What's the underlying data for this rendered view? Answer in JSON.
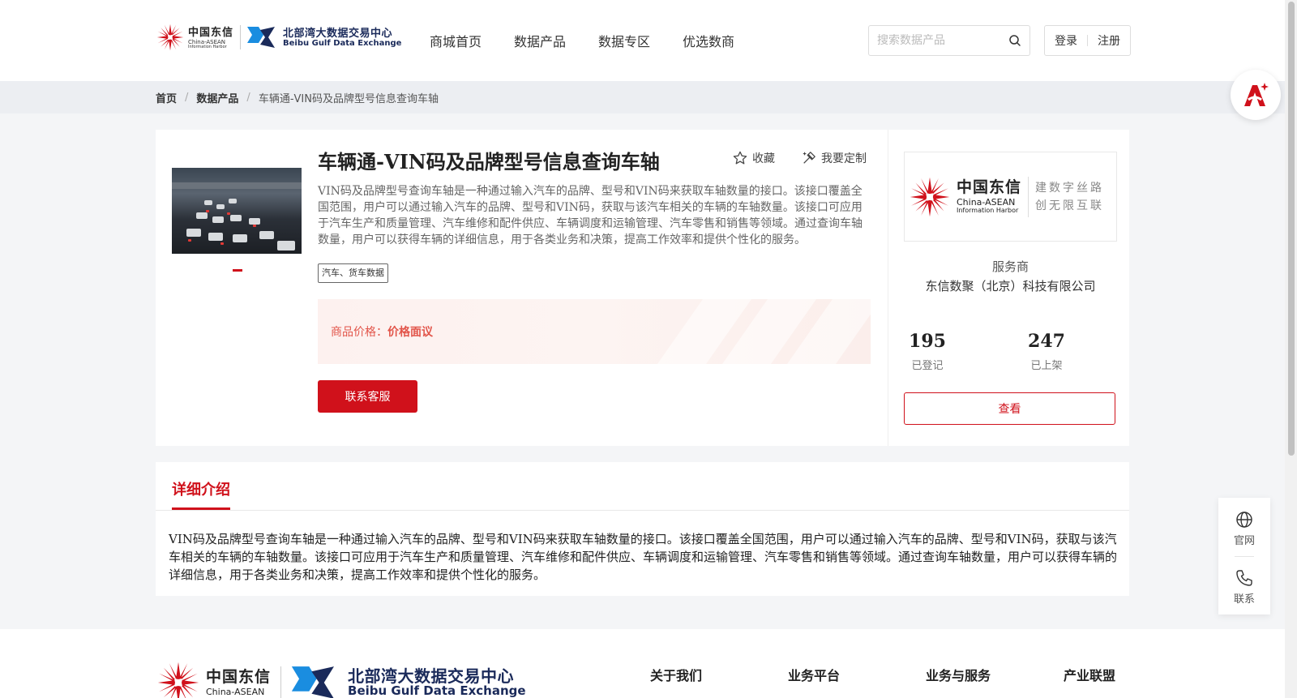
{
  "header": {
    "logo_cn": "中国东信",
    "logo_cn_en1": "China-ASEAN",
    "logo_cn_en2": "Information Harbor",
    "logo_bg_cn": "北部湾大数据交易中心",
    "logo_bg_en": "Beibu Gulf Data Exchange",
    "nav": [
      "商城首页",
      "数据产品",
      "数据专区",
      "优选数商"
    ],
    "search_placeholder": "搜索数据产品",
    "login": "登录",
    "register": "注册"
  },
  "breadcrumb": [
    "首页",
    "数据产品",
    "车辆通-VIN码及品牌型号信息查询车轴"
  ],
  "product": {
    "title": "车辆通-VIN码及品牌型号信息查询车轴",
    "favorite": "收藏",
    "customize": "我要定制",
    "description": "VIN码及品牌型号查询车轴是一种通过输入汽车的品牌、型号和VIN码来获取车轴数量的接口。该接口覆盖全国范围，用户可以通过输入汽车的品牌、型号和VIN码，获取与该汽车相关的车辆的车轴数量。该接口可应用于汽车生产和质量管理、汽车维修和配件供应、车辆调度和运输管理、汽车零售和销售等领域。通过查询车轴数量，用户可以获得车辆的详细信息，用于各类业务和决策，提高工作效率和提供个性化的服务。",
    "tag": "汽车、货车数据",
    "price_label": "商品价格：",
    "price_value": "价格面议",
    "contact_button": "联系客服"
  },
  "vendor": {
    "logo_cn": "中国东信",
    "logo_en1": "China-ASEAN",
    "logo_en2": "Information Harbor",
    "slogan1": "建数字丝路",
    "slogan2": "创无限互联",
    "label": "服务商",
    "name": "东信数聚（北京）科技有限公司",
    "registered_count": "195",
    "registered_label": "已登记",
    "listed_count": "247",
    "listed_label": "已上架",
    "view_button": "查看"
  },
  "details": {
    "tab": "详细介绍",
    "text": "VIN码及品牌型号查询车轴是一种通过输入汽车的品牌、型号和VIN码来获取车轴数量的接口。该接口覆盖全国范围，用户可以通过输入汽车的品牌、型号和VIN码，获取与该汽车相关的车辆的车轴数量。该接口可应用于汽车生产和质量管理、汽车维修和配件供应、车辆调度和运输管理、汽车零售和销售等领域。通过查询车轴数量，用户可以获得车辆的详细信息，用于各类业务和决策，提高工作效率和提供个性化的服务。"
  },
  "side_float": {
    "website": "官网",
    "contact": "联系"
  },
  "footer": {
    "logo_cn": "中国东信",
    "logo_en": "China-ASEAN",
    "logo_bg_cn": "北部湾大数据交易中心",
    "logo_bg_en": "Beibu Gulf Data Exchange",
    "links": [
      "关于我们",
      "业务平台",
      "业务与服务",
      "产业联盟"
    ]
  },
  "colors": {
    "brand_red": "#d0111b",
    "price_orange": "#e2554a",
    "navy": "#1a2a5a"
  },
  "icons": [
    "burst-logo-icon",
    "bg-exchange-logo-icon",
    "search-icon",
    "ai-assistant-icon",
    "star-icon",
    "customize-icon",
    "globe-icon",
    "phone-icon"
  ]
}
